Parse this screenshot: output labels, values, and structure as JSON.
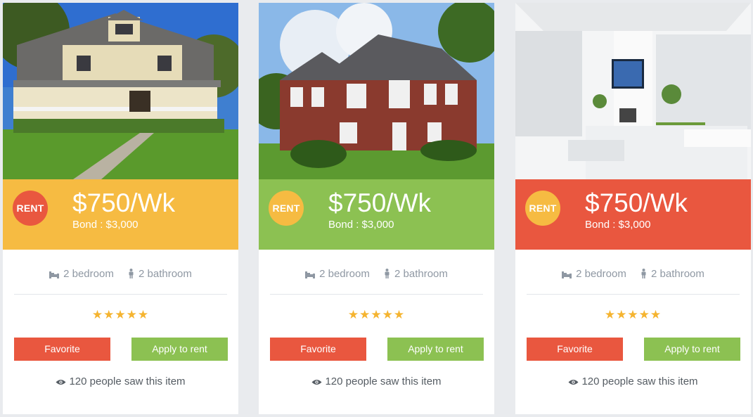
{
  "colors": {
    "yellow": "#f6bb42",
    "green": "#8cc152",
    "red": "#e9573f",
    "star": "#f5b430"
  },
  "cards": [
    {
      "tag": "RENT",
      "price": "$750/Wk",
      "bond": "Bond : $3,000",
      "bedrooms": "2 bedroom",
      "bathrooms": "2 bathroom",
      "rating": 5,
      "favorite_label": "Favorite",
      "apply_label": "Apply to rent",
      "views": "120 people saw this item"
    },
    {
      "tag": "RENT",
      "price": "$750/Wk",
      "bond": "Bond : $3,000",
      "bedrooms": "2 bedroom",
      "bathrooms": "2 bathroom",
      "rating": 5,
      "favorite_label": "Favorite",
      "apply_label": "Apply to rent",
      "views": "120 people saw this item"
    },
    {
      "tag": "RENT",
      "price": "$750/Wk",
      "bond": "Bond : $3,000",
      "bedrooms": "2 bedroom",
      "bathrooms": "2 bathroom",
      "rating": 5,
      "favorite_label": "Favorite",
      "apply_label": "Apply to rent",
      "views": "120 people saw this item"
    }
  ]
}
